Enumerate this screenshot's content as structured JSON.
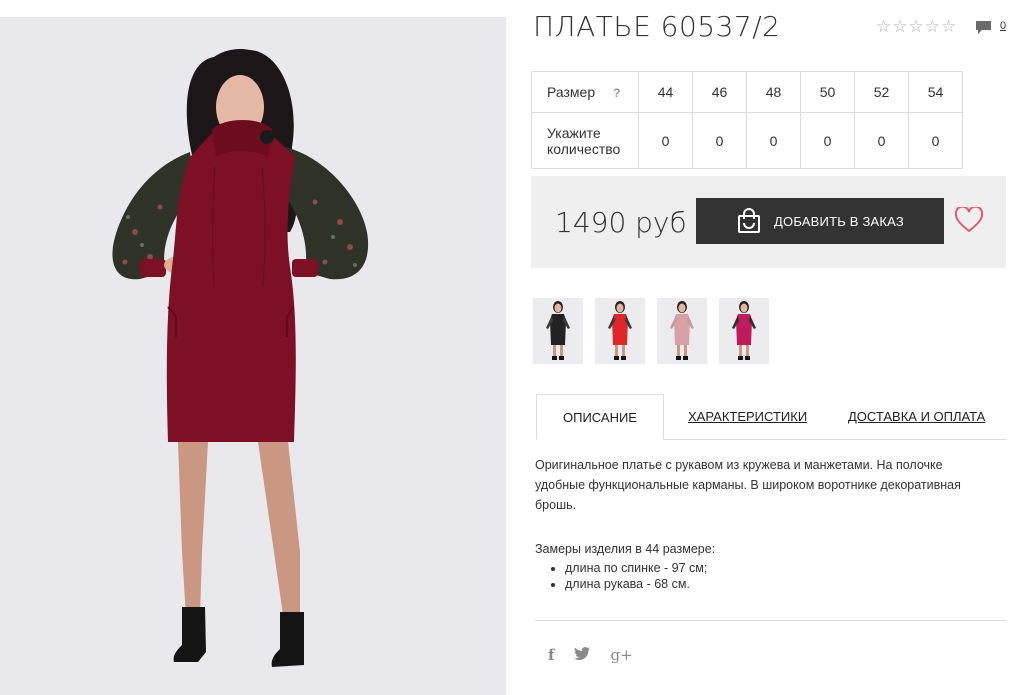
{
  "product": {
    "title": "ПЛАТЬЕ 60537/2",
    "rating_stars": 5,
    "comments_count": "0"
  },
  "size_table": {
    "size_label": "Размер",
    "help": "?",
    "qty_label_line1": "Укажите",
    "qty_label_line2": "количество",
    "sizes": [
      "44",
      "46",
      "48",
      "50",
      "52",
      "54"
    ],
    "quantities": [
      "0",
      "0",
      "0",
      "0",
      "0",
      "0"
    ]
  },
  "purchase": {
    "price": "1490 руб",
    "add_button": "ДОБАВИТЬ В ЗАКАЗ"
  },
  "thumbnails": [
    {
      "color_name": "black",
      "dress": "#222222",
      "sleeve": "#3a3a3a"
    },
    {
      "color_name": "red",
      "dress": "#e0262a",
      "sleeve": "#3a3a3a"
    },
    {
      "color_name": "pink",
      "dress": "#d8a1a8",
      "sleeve": "#c89aa2"
    },
    {
      "color_name": "magenta",
      "dress": "#c01a5a",
      "sleeve": "#3a2a30"
    }
  ],
  "tabs": [
    {
      "label": "ОПИСАНИЕ",
      "active": true
    },
    {
      "label": "ХАРАКТЕРИСТИКИ",
      "active": false
    },
    {
      "label": "ДОСТАВКА И ОПЛАТА",
      "active": false
    }
  ],
  "description": {
    "text": "Оригинальное платье с рукавом из кружева и манжетами. На полочке удобные функциональные карманы. В широком воротнике декоративная брошь.",
    "measurements_title": "Замеры изделия в 44 размере:",
    "measurements": [
      "длина по спинке - 97 см;",
      "длина рукава - 68 см."
    ]
  },
  "share": {
    "icons": [
      "facebook-icon",
      "twitter-icon",
      "google-plus-icon"
    ],
    "facebook": "f",
    "twitter": "🐦",
    "google_plus": "g+"
  },
  "colors": {
    "dark_button": "#333333",
    "price_panel": "#efefef",
    "heart": "#e05a6a",
    "main_dress": "#7d1024"
  }
}
